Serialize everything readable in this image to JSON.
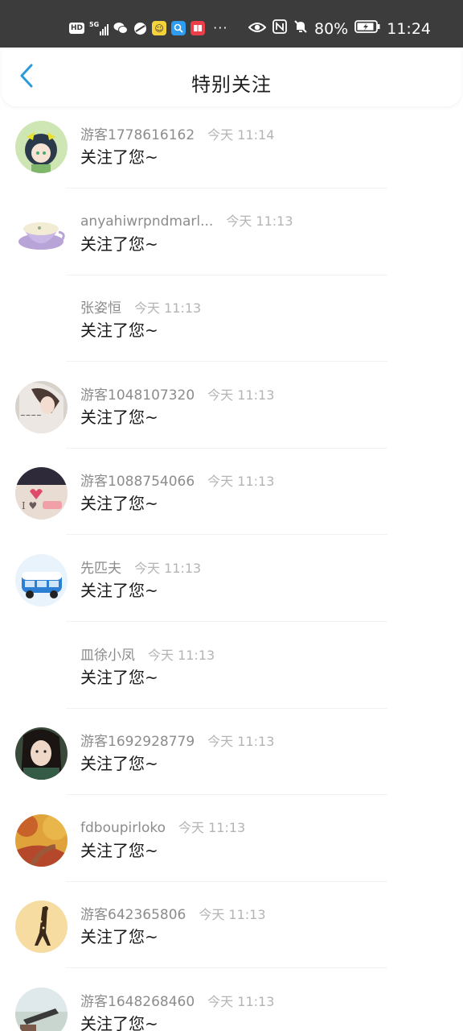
{
  "status_bar": {
    "hd_badge": "HD",
    "network": "5G",
    "battery": "80%",
    "time": "11:24",
    "more": "···",
    "icons": [
      "hd-icon",
      "signal-5g-icon",
      "wechat-icon",
      "browser-icon",
      "qq-icon",
      "search-app-icon",
      "book-app-icon",
      "eye-icon",
      "nfc-icon",
      "mute-icon",
      "battery-icon"
    ]
  },
  "header": {
    "title": "特别关注",
    "back_icon": "chevron-left-icon"
  },
  "colors": {
    "accent": "#2a9bd8",
    "status_bar_bg": "#3c3c3c",
    "name_text": "#8c8c8c",
    "time_text": "#b4b4b4"
  },
  "items": [
    {
      "name": "游客1778616162",
      "time": "今天 11:14",
      "message": "关注了您~",
      "avatar": "anime-girl-avatar"
    },
    {
      "name": "anyahiwrpndmarl...",
      "time": "今天 11:13",
      "message": "关注了您~",
      "avatar": "teacup-avatar"
    },
    {
      "name": "张姿恒",
      "time": "今天 11:13",
      "message": "关注了您~",
      "avatar": ""
    },
    {
      "name": "游客1048107320",
      "time": "今天 11:13",
      "message": "关注了您~",
      "avatar": "girl-photo-avatar"
    },
    {
      "name": "游客1088754066",
      "time": "今天 11:13",
      "message": "关注了您~",
      "avatar": "love-text-avatar"
    },
    {
      "name": "先匹夫",
      "time": "今天 11:13",
      "message": "关注了您~",
      "avatar": "blue-van-avatar"
    },
    {
      "name": "皿徐小凤",
      "time": "今天 11:13",
      "message": "关注了您~",
      "avatar": ""
    },
    {
      "name": "游客1692928779",
      "time": "今天 11:13",
      "message": "关注了您~",
      "avatar": "portrait-avatar"
    },
    {
      "name": "fdboupirloko",
      "time": "今天 11:13",
      "message": "关注了您~",
      "avatar": "autumn-road-avatar"
    },
    {
      "name": "游客642365806",
      "time": "今天 11:13",
      "message": "关注了您~",
      "avatar": "giraffe-avatar"
    },
    {
      "name": "游客1648268460",
      "time": "今天 11:13",
      "message": "关注了您~",
      "avatar": "beach-photo-avatar"
    }
  ]
}
